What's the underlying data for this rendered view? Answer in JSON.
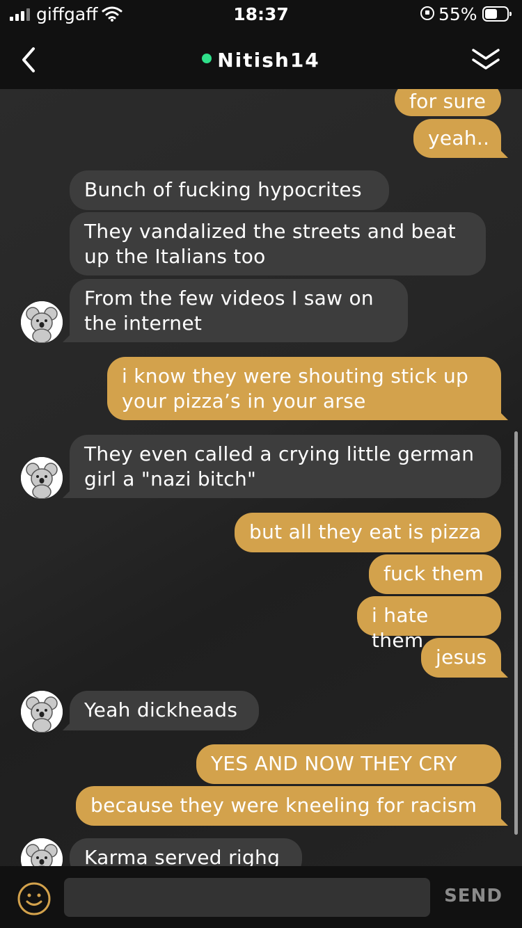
{
  "status_bar": {
    "carrier": "giffgaff",
    "time": "18:37",
    "battery_percent_label": "55%",
    "battery_level": 0.55,
    "icons": [
      "signal-icon",
      "wifi-icon",
      "orientation-lock-icon",
      "battery-icon"
    ]
  },
  "header": {
    "contact_name": "Nitish14",
    "online": true,
    "online_color": "#2fe08a",
    "icons": [
      "back-chevron-icon",
      "collapse-double-chevron-icon"
    ]
  },
  "colors": {
    "outgoing_bubble": "#d3a24c",
    "incoming_bubble": "#3d3d3d",
    "background": "#262626",
    "bar": "#111111"
  },
  "messages": [
    {
      "dir": "out",
      "text": "for sure"
    },
    {
      "dir": "out",
      "text": "yeah.."
    },
    {
      "dir": "in",
      "text": "Bunch of fucking hypocrites"
    },
    {
      "dir": "in",
      "text": "They vandalized the streets and beat up the Italians too"
    },
    {
      "dir": "in",
      "text": "From the few videos I saw on the internet"
    },
    {
      "dir": "out",
      "text": "i know they were shouting stick up your pizza’s in your arse"
    },
    {
      "dir": "in",
      "text": "They even called a crying little german girl a \"nazi bitch\""
    },
    {
      "dir": "out",
      "text": "but all they eat is pizza"
    },
    {
      "dir": "out",
      "text": "fuck them"
    },
    {
      "dir": "out",
      "text": "i hate them"
    },
    {
      "dir": "out",
      "text": "jesus"
    },
    {
      "dir": "in",
      "text": "Yeah dickheads"
    },
    {
      "dir": "out",
      "text": "YES AND NOW THEY CRY"
    },
    {
      "dir": "out",
      "text": "because they were kneeling for racism"
    },
    {
      "dir": "in",
      "text": "Karma served righg"
    }
  ],
  "composer": {
    "input_value": "",
    "send_label": "SEND",
    "icons": [
      "emoji-icon"
    ]
  }
}
